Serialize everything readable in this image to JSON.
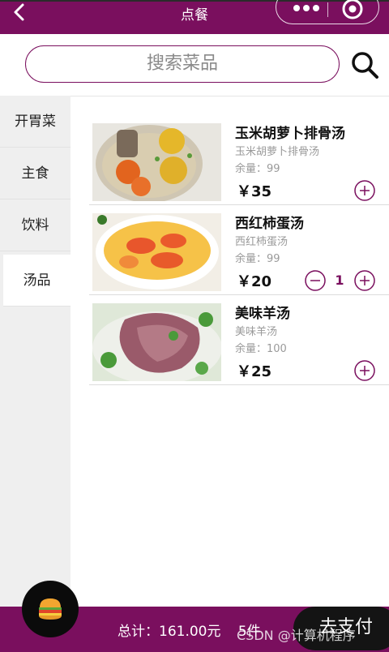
{
  "header": {
    "title": "点餐"
  },
  "search": {
    "placeholder": "搜索菜品"
  },
  "categories": [
    "开胃菜",
    "主食",
    "饮料",
    "汤品"
  ],
  "dishes": [
    {
      "name": "玉米胡萝卜排骨汤",
      "desc": "玉米胡萝卜排骨汤",
      "stock": "余量：99",
      "price": "￥35"
    },
    {
      "name": "西红柿蛋汤",
      "desc": "西红柿蛋汤",
      "stock": "余量：99",
      "price": "￥20",
      "qty": "1"
    },
    {
      "name": "美味羊汤",
      "desc": "美味羊汤",
      "stock": "余量：100",
      "price": "￥25"
    }
  ],
  "footer": {
    "total": "总计：161.00元",
    "count": "5件",
    "pay_label": "去支付"
  },
  "watermark": "CSDN @计算机程序",
  "colors": {
    "accent": "#7a0f5e"
  },
  "icons": [
    "back-icon",
    "more-dots-icon",
    "target-icon",
    "search-icon",
    "plus-icon",
    "minus-icon",
    "burger-icon"
  ]
}
